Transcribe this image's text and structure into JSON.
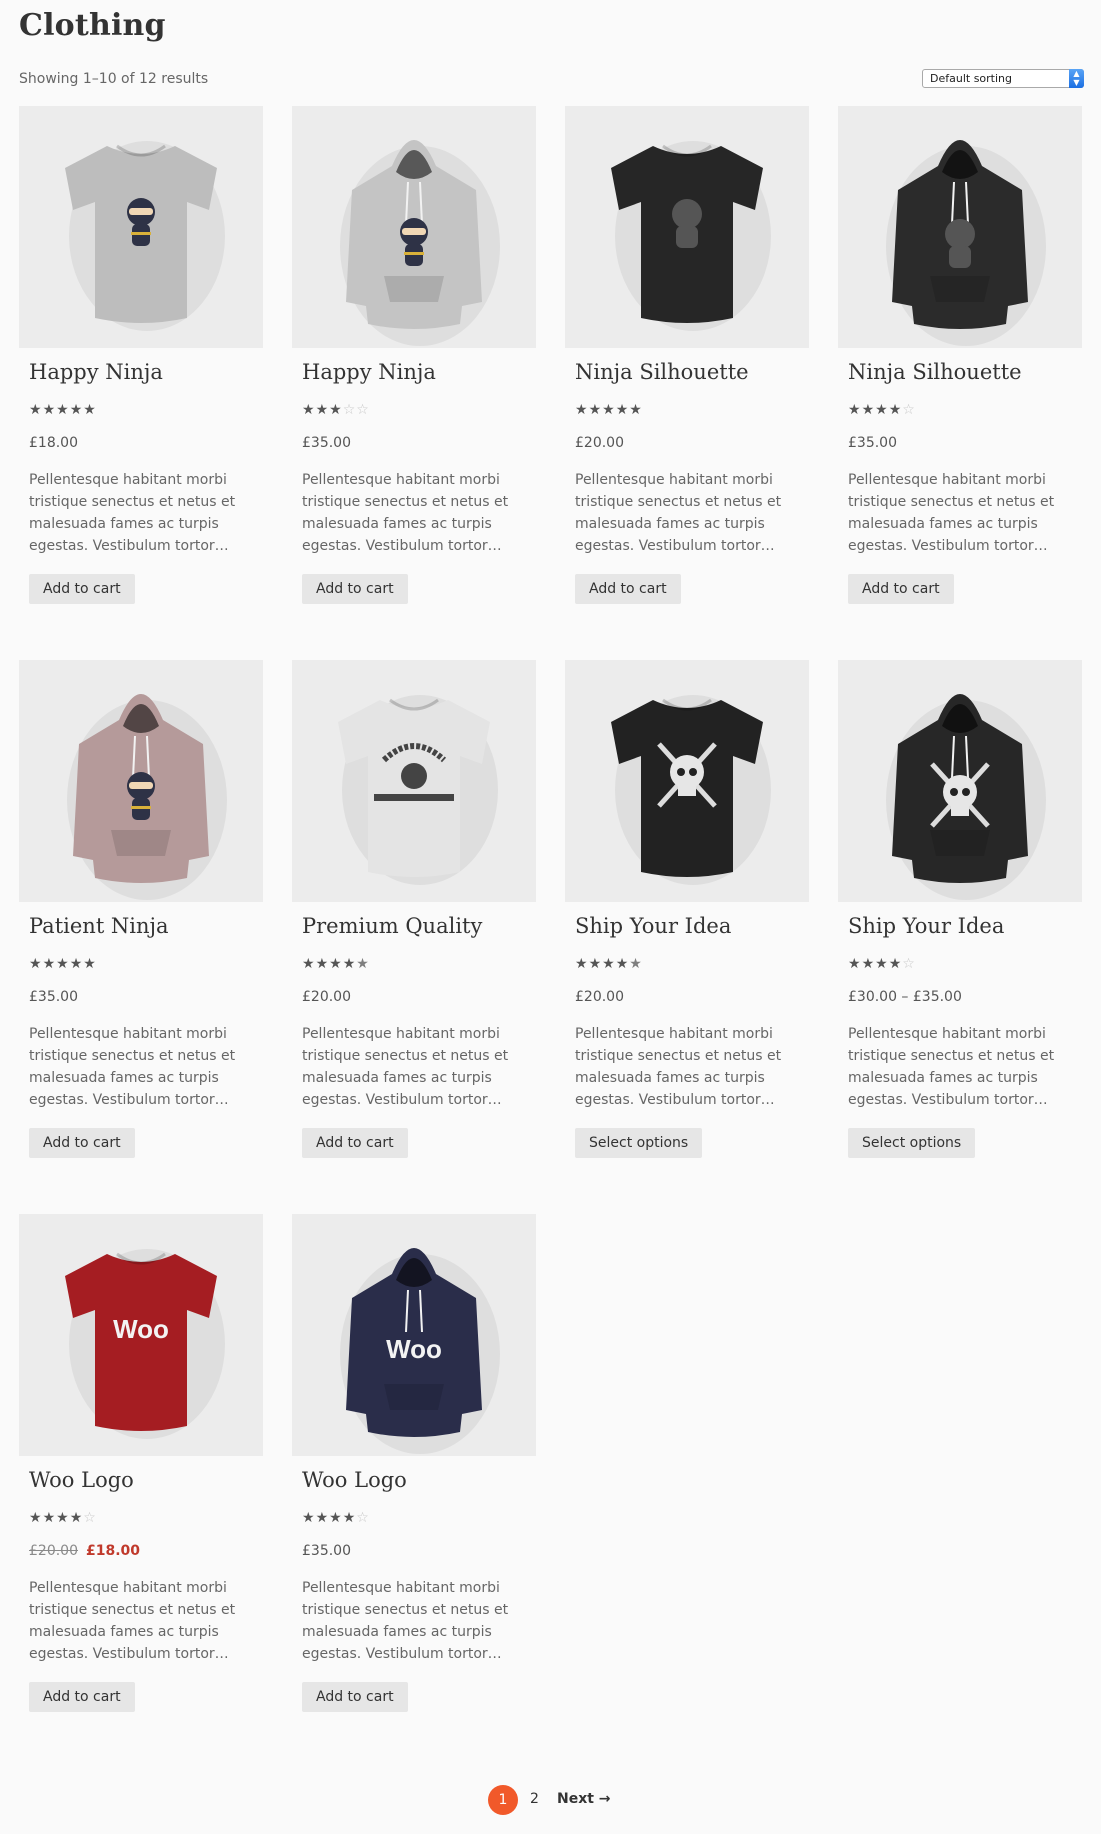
{
  "page": {
    "title": "Clothing",
    "result_count": "Showing 1–10 of 12 results",
    "sort": {
      "selected": "Default sorting"
    }
  },
  "products": [
    {
      "name": "Happy Ninja",
      "rating": 5,
      "price": "£18.00",
      "description": "Pellentesque habitant morbi tristique senectus et netus et malesuada fames ac turpis egestas. Vestibulum tortor…",
      "button": "Add to cart",
      "image": {
        "kind": "tshirt",
        "color": "#bdbdbd",
        "graphic": "ninja"
      }
    },
    {
      "name": "Happy Ninja",
      "rating": 3,
      "price": "£35.00",
      "description": "Pellentesque habitant morbi tristique senectus et netus et malesuada fames ac turpis egestas. Vestibulum tortor…",
      "button": "Add to cart",
      "image": {
        "kind": "hoodie",
        "color": "#c4c4c4",
        "graphic": "ninja"
      }
    },
    {
      "name": "Ninja Silhouette",
      "rating": 5,
      "price": "£20.00",
      "description": "Pellentesque habitant morbi tristique senectus et netus et malesuada fames ac turpis egestas. Vestibulum tortor…",
      "button": "Add to cart",
      "image": {
        "kind": "tshirt",
        "color": "#262626",
        "graphic": "silhouette"
      }
    },
    {
      "name": "Ninja Silhouette",
      "rating": 4,
      "price": "£35.00",
      "description": "Pellentesque habitant morbi tristique senectus et netus et malesuada fames ac turpis egestas. Vestibulum tortor…",
      "button": "Add to cart",
      "image": {
        "kind": "hoodie",
        "color": "#2b2b2b",
        "graphic": "silhouette"
      }
    },
    {
      "name": "Patient Ninja",
      "rating": 5,
      "price": "£35.00",
      "description": "Pellentesque habitant morbi tristique senectus et netus et malesuada fames ac turpis egestas. Vestibulum tortor…",
      "button": "Add to cart",
      "image": {
        "kind": "hoodie",
        "color": "#b59a9a",
        "graphic": "ninja"
      }
    },
    {
      "name": "Premium Quality",
      "rating": 4.5,
      "price": "£20.00",
      "description": "Pellentesque habitant morbi tristique senectus et netus et malesuada fames ac turpis egestas. Vestibulum tortor…",
      "button": "Add to cart",
      "image": {
        "kind": "tshirt",
        "color": "#e4e4e4",
        "graphic": "woothemes"
      }
    },
    {
      "name": "Ship Your Idea",
      "rating": 4.5,
      "price": "£20.00",
      "description": "Pellentesque habitant morbi tristique senectus et netus et malesuada fames ac turpis egestas. Vestibulum tortor…",
      "button": "Select options",
      "image": {
        "kind": "tshirt",
        "color": "#222222",
        "graphic": "skull"
      }
    },
    {
      "name": "Ship Your Idea",
      "rating": 4,
      "price": "£30.00 – £35.00",
      "description": "Pellentesque habitant morbi tristique senectus et netus et malesuada fames ac turpis egestas. Vestibulum tortor…",
      "button": "Select options",
      "image": {
        "kind": "hoodie",
        "color": "#272727",
        "graphic": "skull"
      }
    },
    {
      "name": "Woo Logo",
      "rating": 4,
      "price_old": "£20.00",
      "price": "£18.00",
      "description": "Pellentesque habitant morbi tristique senectus et netus et malesuada fames ac turpis egestas. Vestibulum tortor…",
      "button": "Add to cart",
      "image": {
        "kind": "tshirt",
        "color": "#a51d22",
        "graphic": "woo"
      }
    },
    {
      "name": "Woo Logo",
      "rating": 4,
      "price": "£35.00",
      "description": "Pellentesque habitant morbi tristique senectus et netus et malesuada fames ac turpis egestas. Vestibulum tortor…",
      "button": "Add to cart",
      "image": {
        "kind": "hoodie",
        "color": "#2a2d4a",
        "graphic": "woo"
      }
    }
  ],
  "pagination": {
    "current": "1",
    "page2": "2",
    "next": "Next →"
  },
  "colors": {
    "accent": "#f1592a",
    "sale": "#c0392b",
    "button_bg": "#e6e6e6"
  }
}
